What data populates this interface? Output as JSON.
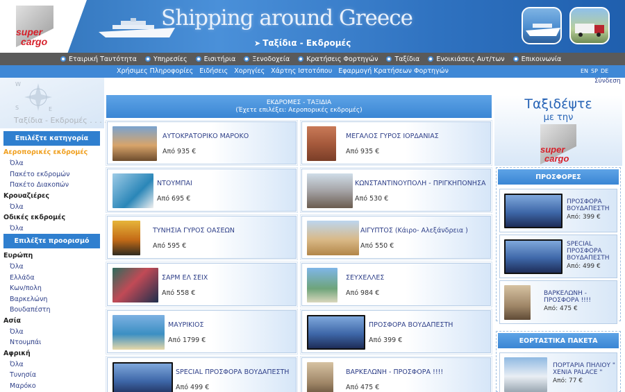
{
  "header": {
    "logo_line1": "super",
    "logo_line2": "cargo",
    "site_title": "Shipping around Greece",
    "section_title": "Ταξίδια - Εκδρομές"
  },
  "nav_main": [
    "Εταιρική Ταυτότητα",
    "Υπηρεσίες",
    "Εισιτήρια",
    "Ξενοδοχεία",
    "Κρατήσεις Φορτηγών",
    "Ταξίδια",
    "Ενοικιάσεις Αυτ/των",
    "Επικοινωνία"
  ],
  "nav_sub": [
    "Χρήσιμες Πληροφορίες",
    "Ειδήσεις",
    "Χορηγίες",
    "Χάρτης Ιστοτόπου",
    "Εφαρμογή Κρατήσεων Φορτηγών"
  ],
  "languages": [
    "EN",
    "SP",
    "DE"
  ],
  "login": "Σύνδεση",
  "sidebar": {
    "compass_label": "Ταξίδια - Εκδρομές . . . .",
    "category_header": "Επιλέξτε κατηγορία",
    "categories": [
      {
        "label": "Αεροπορικές εκδρομές",
        "active": true,
        "subs": [
          "Όλα",
          "Πακέτο εκδρομών",
          "Πακέτο Διακοπών"
        ]
      },
      {
        "label": "Κρουαζιέρες",
        "active": false,
        "subs": [
          "Όλα"
        ]
      },
      {
        "label": "Οδικές εκδρομές",
        "active": false,
        "subs": [
          "Όλα"
        ]
      }
    ],
    "destination_header": "Επιλέξτε προορισμό",
    "destinations": [
      {
        "label": "Ευρώπη",
        "subs": [
          "Όλα",
          "Ελλάδα",
          "Κων/πολη",
          "Βαρκελώνη",
          "Βουδαπέστη"
        ]
      },
      {
        "label": "Ασία",
        "subs": [
          "Όλα",
          "Ντουμπάι"
        ]
      },
      {
        "label": "Αφρική",
        "subs": [
          "Όλα",
          "Τυνησία",
          "Μαρόκο"
        ]
      }
    ]
  },
  "center": {
    "header_line1": "ΕΚΔΡΟΜΕΣ - ΤΑΞΙΔΙΑ",
    "header_line2": "(Έχετε επιλέξει: Αεροπορικές εκδρομές)",
    "tours": [
      {
        "title": "ΑΥΤΟΚΡΑΤΟΡΙΚΟ ΜΑΡΟΚΟ",
        "price": "Από 935 €",
        "image": "morocco"
      },
      {
        "title": "ΜΕΓΑΛΟΣ ΓΥΡΟΣ ΙΟΡΔΑΝΙΑΣ",
        "price": "Από 935 €",
        "image": "petra"
      },
      {
        "title": "ΝΤΟΥΜΠΑΙ",
        "price": "Από 695 €",
        "image": "dubai"
      },
      {
        "title": "ΚΩΝΣΤΑΝΤΙΝΟΥΠΟΛΗ - ΠΡΙΓΚΗΠΟΝΗΣΑ",
        "price": "Από 530 €",
        "image": "istanbul"
      },
      {
        "title": "ΤΥΝΗΣΙΑ ΓΥΡΟΣ ΟΑΣΕΩΝ",
        "price": "Από 595 €",
        "image": "tunisia"
      },
      {
        "title": "ΑΙΓΥΠΤΟΣ (Κάιρο- Αλεξάνδρεια )",
        "price": "Από 550 €",
        "image": "egypt"
      },
      {
        "title": "ΣΑΡΜ ΕΛ ΣΕΙΧ",
        "price": "Από 558 €",
        "image": "sharm"
      },
      {
        "title": "ΣΕΥΧΕΛΛΕΣ",
        "price": "Από 984 €",
        "image": "seychelles"
      },
      {
        "title": "ΜΑΥΡΙΚΙΟΣ",
        "price": "Από 1799 €",
        "image": "mauritius"
      },
      {
        "title": "ΠΡΟΣΦΟΡΑ ΒΟΥΔΑΠΕΣΤΗ",
        "price": "Από 399 €",
        "image": "budapest"
      },
      {
        "title": "SPECIAL ΠΡΟΣΦΟΡΑ ΒΟΥΔΑΠΕΣΤΗ",
        "price": "Από 499 €",
        "image": "budapest"
      },
      {
        "title": "ΒΑΡΚΕΛΩΝΗ - ΠΡΟΣΦΟΡΑ !!!!",
        "price": "Από 475 €",
        "image": "barcelona"
      }
    ]
  },
  "right": {
    "ad_line1": "Ταξιδέψτε",
    "ad_line2": "με την",
    "offers_header": "ΠΡΟΣΦΟΡΕΣ",
    "offers": [
      {
        "title": "ΠΡΟΣΦΟΡΑ ΒΟΥΔΑΠΕΣΤΗ",
        "price": "Από: 399 €",
        "image": "budapest"
      },
      {
        "title": "SPECIAL ΠΡΟΣΦΟΡΑ ΒΟΥΔΑΠΕΣΤΗ",
        "price": "Από: 499 €",
        "image": "budapest"
      },
      {
        "title": "ΒΑΡΚΕΛΩΝΗ - ΠΡΟΣΦΟΡΑ !!!!",
        "price": "Από: 475 €",
        "image": "barcelona"
      }
    ],
    "holiday_header": "ΕΟΡΤΑΣΤΙΚΑ ΠΑΚΕΤΑ",
    "holiday": [
      {
        "title": "ΠΟΡΤΑΡΙΑ ΠΗΛΙΟΥ \" ΧΕΝΙΑ PALACE \"",
        "price": "Από: 77 €",
        "image": "snow"
      }
    ]
  },
  "colors": {
    "header_blue": "#3f88d6",
    "nav_grey": "#5a5a5a",
    "link_navy": "#2e3f88",
    "active_orange": "#f0a020",
    "brand_red": "#d6202a"
  }
}
